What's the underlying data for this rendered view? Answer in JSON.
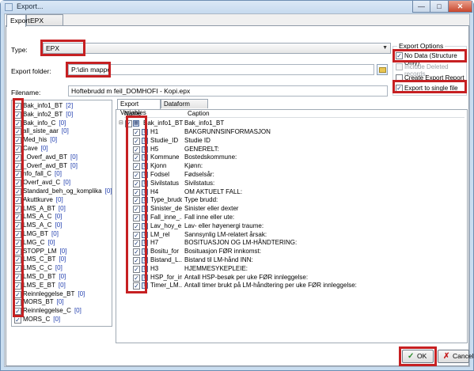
{
  "window": {
    "title": "Export..."
  },
  "tabs": [
    {
      "label": "Export"
    },
    {
      "label": "EPX Options"
    }
  ],
  "form": {
    "type_label": "Type:",
    "type_value": "EPX",
    "folder_label": "Export folder:",
    "folder_value": "P:\\din mappe",
    "filename_label": "Filename:",
    "filename_value": "Hoftebrudd m feil_DOMHOFI - Kopi.epx"
  },
  "export_options": {
    "title": "Export Options",
    "items": [
      {
        "label": "No Data (Structure Only)",
        "checked": true,
        "enabled": true
      },
      {
        "label": "Include Deleted records",
        "checked": false,
        "enabled": false
      },
      {
        "label": "Create Export Report",
        "checked": false,
        "enabled": true
      },
      {
        "label": "Export to single file",
        "checked": true,
        "enabled": true
      }
    ]
  },
  "datasets": [
    {
      "name": "Bak_info1_BT",
      "count": "[2]"
    },
    {
      "name": "Bak_info2_BT",
      "count": "[0]"
    },
    {
      "name": "Bak_info_C",
      "count": "[0]"
    },
    {
      "name": "all_siste_aar",
      "count": "[0]"
    },
    {
      "name": "Med_his",
      "count": "[0]"
    },
    {
      "name": "Cave",
      "count": "[0]"
    },
    {
      "name": "_Overf_avd_BT",
      "count": "[0]"
    },
    {
      "name": "_Overf_avd_BT",
      "count": "[0]"
    },
    {
      "name": "nfo_fall_C",
      "count": "[0]"
    },
    {
      "name": "Overf_avd_C",
      "count": "[0]"
    },
    {
      "name": "Standard_beh_og_komplika",
      "count": "[0]"
    },
    {
      "name": "Akuttkurve",
      "count": "[0]"
    },
    {
      "name": "LMS_A_BT",
      "count": "[0]"
    },
    {
      "name": "LMS_A_C",
      "count": "[0]"
    },
    {
      "name": "LMS_A_C",
      "count": "[0]"
    },
    {
      "name": "LMG_BT",
      "count": "[0]"
    },
    {
      "name": "LMG_C",
      "count": "[0]"
    },
    {
      "name": "STOPP_LM",
      "count": "[0]"
    },
    {
      "name": "LMS_C_BT",
      "count": "[0]"
    },
    {
      "name": "LMS_C_C",
      "count": "[0]"
    },
    {
      "name": "LMS_D_BT",
      "count": "[0]"
    },
    {
      "name": "LMS_E_BT",
      "count": "[0]"
    },
    {
      "name": "Reinnleggelse_BT",
      "count": "[0]"
    },
    {
      "name": "MORS_BT",
      "count": "[0]"
    },
    {
      "name": "Reinnleggelse_C",
      "count": "[0]"
    },
    {
      "name": "MORS_C",
      "count": "[0]"
    }
  ],
  "inner_tabs": [
    {
      "label": "Export Variables"
    },
    {
      "label": "Dataform Options"
    }
  ],
  "var_columns": {
    "name": "Name",
    "caption": "Caption"
  },
  "root_var": {
    "name": "Bak_info1_BT",
    "caption": "Bak_info1_BT"
  },
  "variables": [
    {
      "name": "H1",
      "caption": "BAKGRUNNSINFORMASJON"
    },
    {
      "name": "Studie_ID",
      "caption": "Studie ID"
    },
    {
      "name": "H5",
      "caption": "GENERELT:"
    },
    {
      "name": "Kommune",
      "caption": "Bostedskommune:"
    },
    {
      "name": "Kjonn",
      "caption": "Kjønn:"
    },
    {
      "name": "Fodsel",
      "caption": "Fødselsår:"
    },
    {
      "name": "Sivilstatus",
      "caption": "Sivilstatus:"
    },
    {
      "name": "H4",
      "caption": "OM AKTUELT FALL:"
    },
    {
      "name": "Type_brudd",
      "caption": "Type brudd:"
    },
    {
      "name": "Sinister_de...",
      "caption": "Sinister eller dexter"
    },
    {
      "name": "Fall_inne_...",
      "caption": "Fall inne eller ute:"
    },
    {
      "name": "Lav_hoy_e...",
      "caption": "Lav- eller høyenergi traume:"
    },
    {
      "name": "LM_rel",
      "caption": "Sannsynlig LM-relatert årsak:"
    },
    {
      "name": "H7",
      "caption": "BOSITUASJON OG LM-HÅNDTERING:"
    },
    {
      "name": "Bositu_for",
      "caption": "Bosituasjon FØR innkomst:"
    },
    {
      "name": "Bistand_L...",
      "caption": "Bistand til LM-hånd INN:"
    },
    {
      "name": "H3",
      "caption": "HJEMMESYKEPLEIE:"
    },
    {
      "name": "HSP_for_in...",
      "caption": "Antall HSP-besøk per uke FØR innleggelse:"
    },
    {
      "name": "Timer_LM...",
      "caption": "Antall timer brukt på LM-håndtering per uke FØR innleggelse:"
    }
  ],
  "buttons": {
    "ok": "OK",
    "cancel": "Cancel"
  }
}
